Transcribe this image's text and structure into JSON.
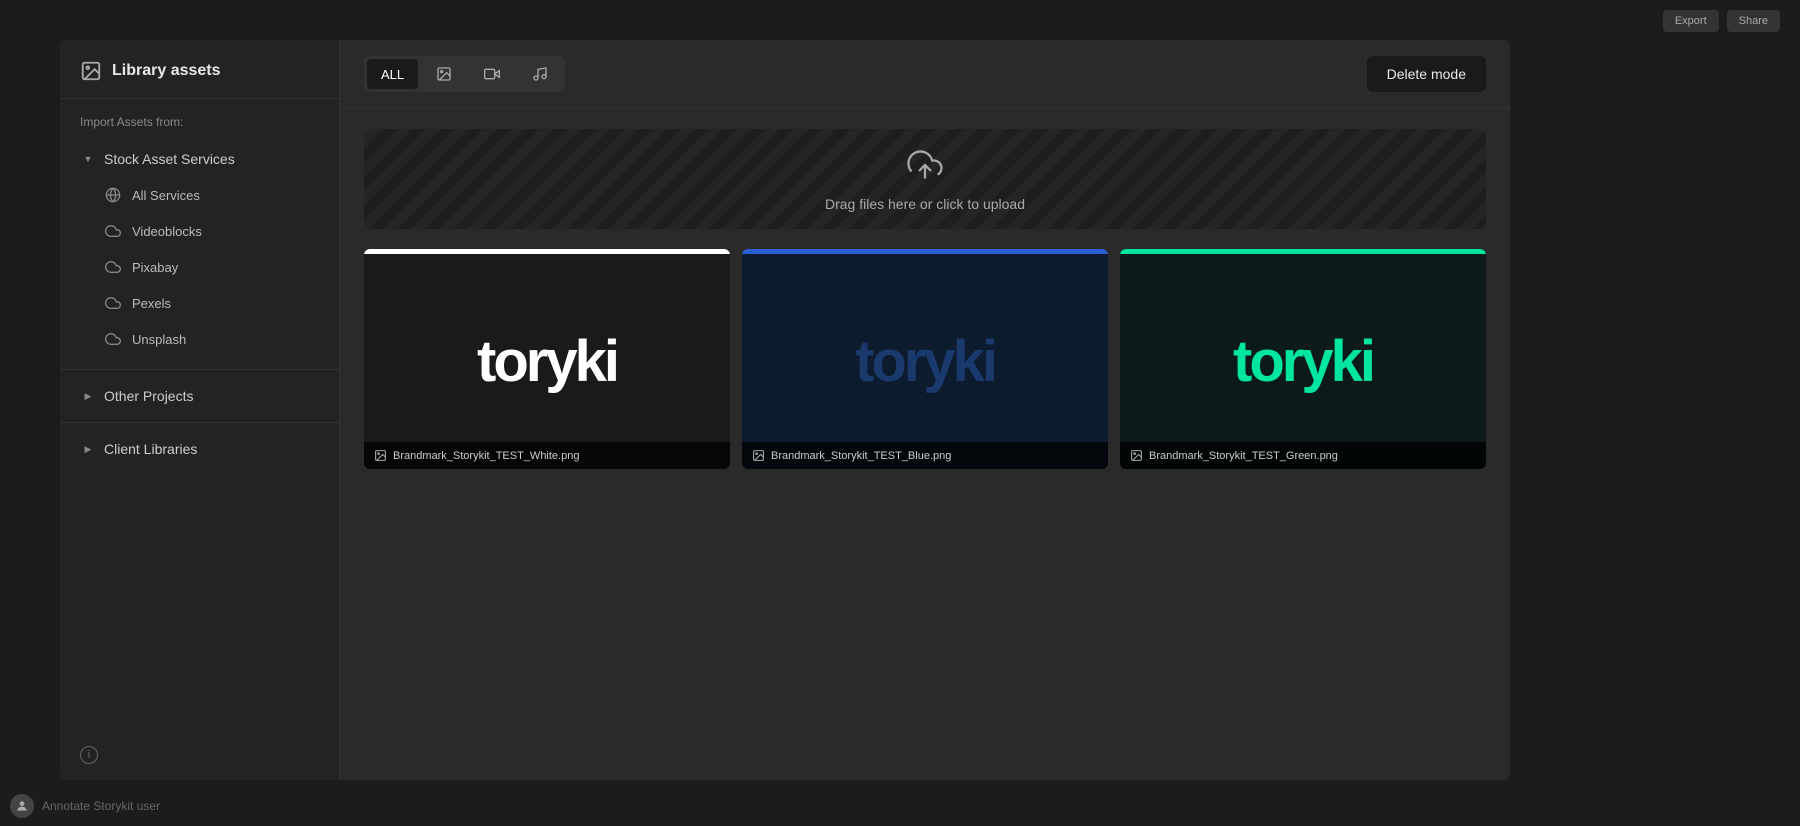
{
  "sidebar": {
    "title": "Library assets",
    "title_icon": "image-icon",
    "import_label": "Import Assets from:",
    "stock_services": {
      "label": "Stock Asset Services",
      "expanded": true,
      "items": [
        {
          "id": "all-services",
          "label": "All Services",
          "icon": "globe-icon"
        },
        {
          "id": "videoblocks",
          "label": "Videoblocks",
          "icon": "cloud-icon"
        },
        {
          "id": "pixabay",
          "label": "Pixabay",
          "icon": "cloud-icon"
        },
        {
          "id": "pexels",
          "label": "Pexels",
          "icon": "cloud-icon"
        },
        {
          "id": "unsplash",
          "label": "Unsplash",
          "icon": "cloud-icon"
        }
      ]
    },
    "other_projects": {
      "label": "Other Projects",
      "expanded": false
    },
    "client_libraries": {
      "label": "Client Libraries",
      "expanded": false
    }
  },
  "toolbar": {
    "filter_tabs": [
      {
        "id": "all",
        "label": "ALL",
        "active": true,
        "icon": null
      },
      {
        "id": "image",
        "label": "",
        "icon": "image-filter-icon"
      },
      {
        "id": "video",
        "label": "",
        "icon": "video-filter-icon"
      },
      {
        "id": "audio",
        "label": "",
        "icon": "audio-filter-icon"
      }
    ],
    "delete_mode_label": "Delete mode"
  },
  "upload_zone": {
    "text": "Drag files here or click to upload",
    "icon": "upload-cloud-icon"
  },
  "assets": [
    {
      "id": "asset-1",
      "filename": "Brandmark_Storykit_TEST_White.png",
      "theme": "white",
      "text": "toryki",
      "top_border_color": "#ffffff",
      "bg_color": "#1a1a1a",
      "text_color": "#ffffff"
    },
    {
      "id": "asset-2",
      "filename": "Brandmark_Storykit_TEST_Blue.png",
      "theme": "blue",
      "text": "toryki",
      "top_border_color": "#2a5fd4",
      "bg_color": "#0d1b2e",
      "text_color": "#1a3a6e"
    },
    {
      "id": "asset-3",
      "filename": "Brandmark_Storykit_TEST_Green.png",
      "theme": "green",
      "text": "toryki",
      "top_border_color": "#00e5a0",
      "bg_color": "#0d1a1a",
      "text_color": "#00e5a0"
    }
  ],
  "background": {
    "user_label": "Annotate Storykit user",
    "top_buttons": [
      "Export",
      "Share"
    ]
  }
}
